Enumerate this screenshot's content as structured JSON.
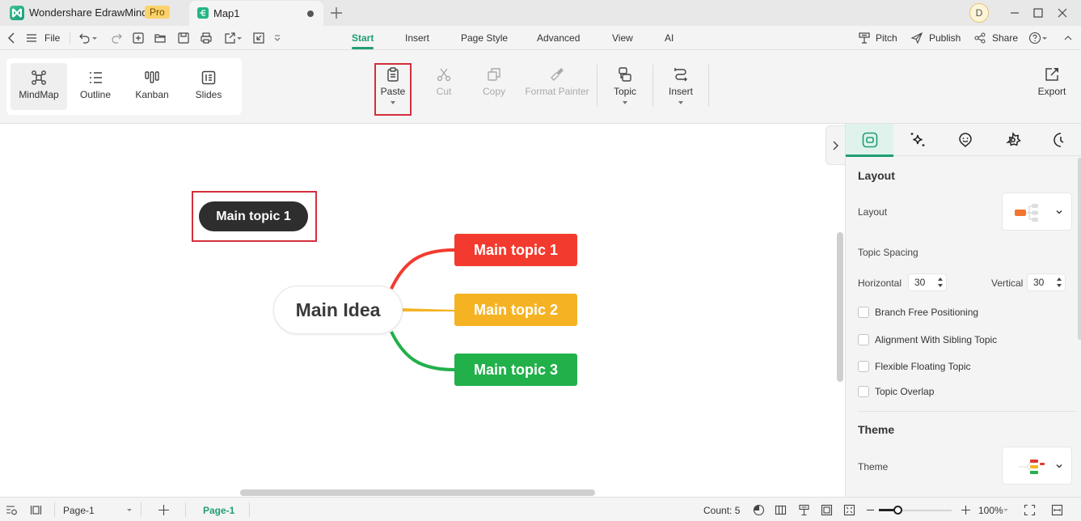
{
  "titlebar": {
    "app_name": "Wondershare EdrawMind",
    "badge": "Pro",
    "document_tab": "Map1",
    "user_initial": "D"
  },
  "menubar": {
    "file_label": "File",
    "tabs": [
      {
        "label": "Start",
        "active": true
      },
      {
        "label": "Insert",
        "active": false
      },
      {
        "label": "Page Style",
        "active": false
      },
      {
        "label": "Advanced",
        "active": false
      },
      {
        "label": "View",
        "active": false
      },
      {
        "label": "AI",
        "active": false
      }
    ],
    "right": {
      "pitch": "Pitch",
      "publish": "Publish",
      "share": "Share"
    }
  },
  "ribbon": {
    "views": [
      {
        "label": "MindMap",
        "icon": "mindmap-icon",
        "active": true
      },
      {
        "label": "Outline",
        "icon": "outline-icon",
        "active": false
      },
      {
        "label": "Kanban",
        "icon": "kanban-icon",
        "active": false
      },
      {
        "label": "Slides",
        "icon": "slides-icon",
        "active": false
      }
    ],
    "buttons": [
      {
        "label": "Paste",
        "icon": "paste-icon",
        "enabled": true,
        "dropdown": true,
        "highlighted": true
      },
      {
        "label": "Cut",
        "icon": "scissors-icon",
        "enabled": false,
        "dropdown": false
      },
      {
        "label": "Copy",
        "icon": "copy-icon",
        "enabled": false,
        "dropdown": false
      },
      {
        "label": "Format Painter",
        "icon": "brush-icon",
        "enabled": false,
        "dropdown": false
      },
      {
        "label": "Topic",
        "icon": "topic-icon",
        "enabled": true,
        "dropdown": true
      },
      {
        "label": "Insert",
        "icon": "insert-icon",
        "enabled": true,
        "dropdown": true
      }
    ],
    "export_label": "Export"
  },
  "canvas": {
    "floating_topic": {
      "label": "Main topic 1",
      "highlighted": true
    },
    "central_topic": "Main Idea",
    "topics": [
      {
        "label": "Main topic 1",
        "color": "#f23b2e"
      },
      {
        "label": "Main topic 2",
        "color": "#f5b324"
      },
      {
        "label": "Main topic 3",
        "color": "#22b04b"
      }
    ]
  },
  "panel": {
    "tabs": [
      "layout-tab",
      "ai-tab",
      "sticker-tab",
      "theme-style-tab",
      "history-tab"
    ],
    "layout_heading": "Layout",
    "layout_label": "Layout",
    "topic_spacing_label": "Topic Spacing",
    "horizontal_label": "Horizontal",
    "horizontal_value": "30",
    "vertical_label": "Vertical",
    "vertical_value": "30",
    "checkboxes": [
      {
        "label": "Branch Free Positioning",
        "checked": false
      },
      {
        "label": "Alignment With Sibling Topic",
        "checked": false
      },
      {
        "label": "Flexible Floating Topic",
        "checked": false
      },
      {
        "label": "Topic Overlap",
        "checked": false
      }
    ],
    "theme_heading": "Theme",
    "theme_label": "Theme"
  },
  "statusbar": {
    "page_select": "Page-1",
    "page_tab": "Page-1",
    "count": "Count: 5",
    "zoom_level": "100%",
    "zoom_fraction": 0.25
  },
  "colors": {
    "accent": "#1f9e73",
    "highlight": "#d32f3c"
  }
}
